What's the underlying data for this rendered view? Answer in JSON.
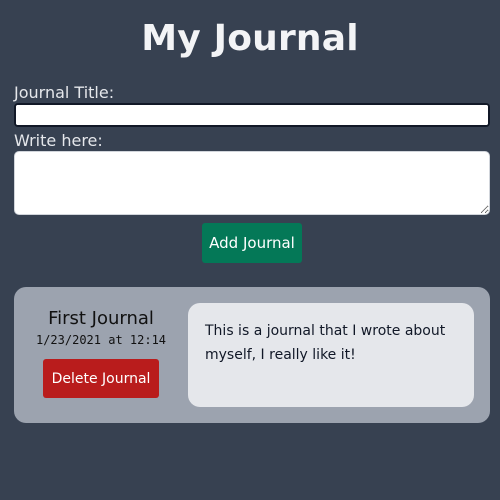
{
  "header": {
    "title": "My Journal"
  },
  "form": {
    "title_label": "Journal Title:",
    "title_value": "",
    "body_label": "Write here:",
    "body_value": "",
    "add_button_label": "Add Journal"
  },
  "journals": [
    {
      "title": "First Journal",
      "date": "1/23/2021 at 12:14",
      "body": "This is a journal that I wrote about myself, I really like it!",
      "delete_button_label": "Delete Journal"
    }
  ],
  "colors": {
    "background": "#374151",
    "add_button": "#047857",
    "delete_button": "#b91c1c",
    "card": "#9ca3af",
    "card_body": "#e5e7eb"
  }
}
